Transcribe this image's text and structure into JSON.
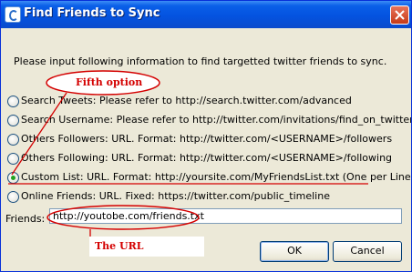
{
  "window": {
    "title": "Find Friends to Sync"
  },
  "instruction": "Please input following information to find targetted twitter friends to sync.",
  "options": [
    {
      "label": "Search Tweets: Please refer to http://search.twitter.com/advanced",
      "checked": false
    },
    {
      "label": "Search Username: Please refer to http://twitter.com/invitations/find_on_twitter",
      "checked": false
    },
    {
      "label": "Others Followers: URL. Format: http://twitter.com/<USERNAME>/followers",
      "checked": false
    },
    {
      "label": "Others Following: URL. Format: http://twitter.com/<USERNAME>/following",
      "checked": false
    },
    {
      "label": "Custom List: URL. Format: http://yoursite.com/MyFriendsList.txt (One per Line)",
      "checked": true
    },
    {
      "label": "Online Friends: URL. Fixed: https://twitter.com/public_timeline",
      "checked": false
    }
  ],
  "friends": {
    "label": "Friends:",
    "value": "http://youtobe.com/friends.txt"
  },
  "buttons": {
    "ok": "OK",
    "cancel": "Cancel"
  },
  "annotations": {
    "fifth_option": "Fifth option",
    "the_url": "The URL"
  },
  "colors": {
    "annotation": "#d40000",
    "titlebar": "#0453e0",
    "window_bg": "#ece9d8"
  },
  "icons": {
    "app": "app-icon",
    "close": "close-icon"
  }
}
